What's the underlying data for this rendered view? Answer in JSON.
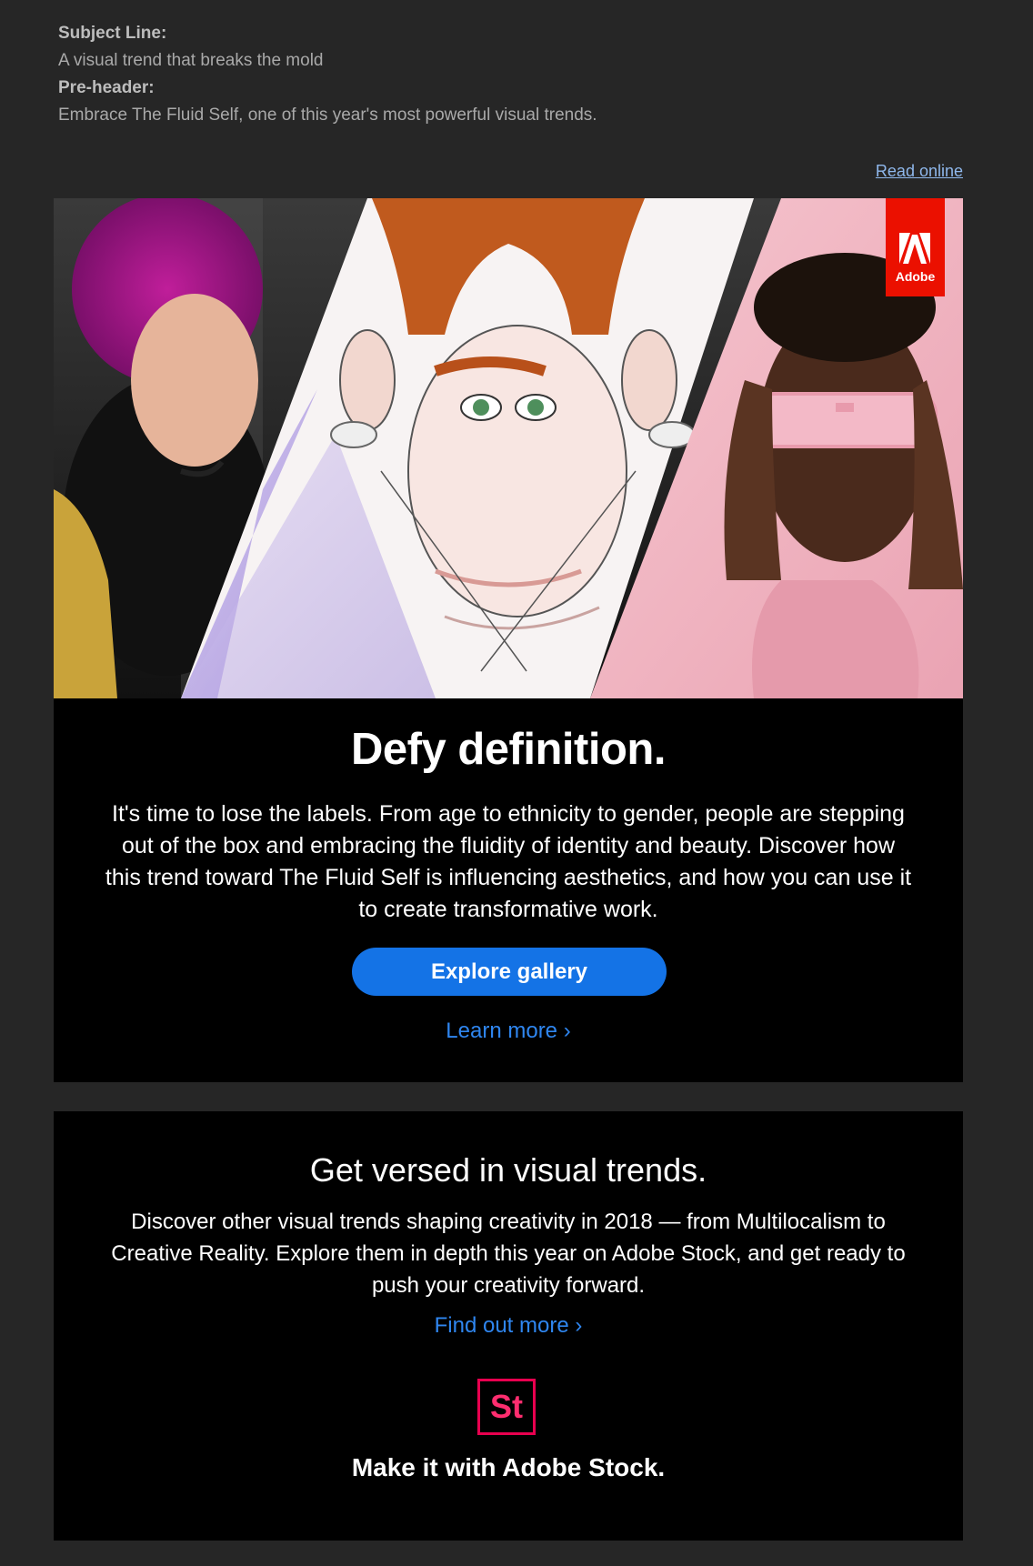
{
  "meta": {
    "subject_label": "Subject Line:",
    "subject_value": "A visual trend that breaks the mold",
    "preheader_label": "Pre-header:",
    "preheader_value": "Embrace The Fluid Self, one of this year's most powerful visual trends."
  },
  "header": {
    "read_online": "Read online"
  },
  "hero": {
    "adobe_logo_text": "Adobe"
  },
  "section1": {
    "title": "Defy definition.",
    "body": "It's time to lose the labels. From age to ethnicity to gender, people are stepping out of the box and embracing the fluidity of identity and beauty. Discover how this trend toward The Fluid Self is influencing aesthetics, and how you can use it to create transformative work.",
    "cta": "Explore gallery",
    "link": "Learn more ›"
  },
  "section2": {
    "title": "Get versed in visual trends.",
    "body": "Discover other visual trends shaping creativity in 2018 — from Multilocalism to Creative Reality. Explore them in depth this year on Adobe Stock, and get ready to push your creativity forward.",
    "link": "Find out more ›",
    "stock_logo": "St",
    "tagline": "Make it with Adobe Stock."
  },
  "colors": {
    "background": "#262626",
    "panel": "#000000",
    "button": "#1473e6",
    "link": "#2f86f0",
    "adobe_red": "#eb1000",
    "stock_pink": "#e8004f"
  }
}
